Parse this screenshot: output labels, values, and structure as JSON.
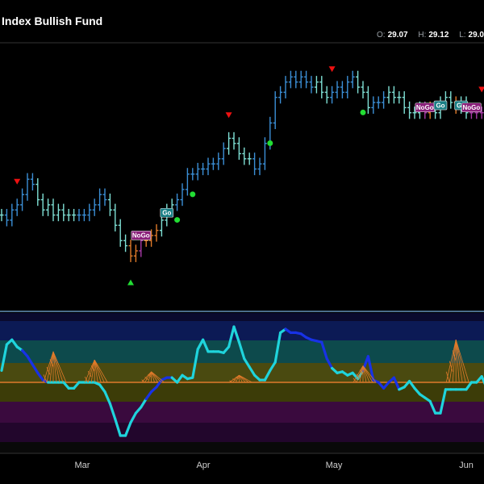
{
  "header": {
    "title": "Index Bullish Fund",
    "ohlc": [
      {
        "key": "O:",
        "value": "29.07"
      },
      {
        "key": "H:",
        "value": "29.12"
      },
      {
        "key": "L:",
        "value": "29.0"
      }
    ]
  },
  "colors": {
    "background": "#000000",
    "strong_up": "#3b8fd6",
    "weak_up": "#7fe0d5",
    "weak_down": "#e07a2a",
    "strong_down": "#a83aa8",
    "buy_marker": "#22dd33",
    "sell_marker": "#ee1111",
    "oscillator": "#1fd4dc",
    "oscillator_strong": "#1832e6",
    "zero_line": "#e07a2a",
    "tag_nogo": "#8a1f7a",
    "tag_go": "#1a7f86"
  },
  "chart_data": [
    {
      "type": "ohlc",
      "title": "Index Bullish Fund",
      "x_months": [
        "Mar",
        "Apr",
        "May",
        "Jun"
      ],
      "price_approx": [
        27.9,
        27.8,
        28.0,
        28.1,
        28.3,
        28.6,
        28.5,
        28.2,
        28.0,
        28.1,
        27.9,
        28.0,
        27.9,
        27.9,
        27.9,
        27.9,
        27.9,
        28.0,
        28.1,
        28.3,
        28.2,
        28.0,
        27.7,
        27.4,
        27.3,
        27.1,
        27.2,
        27.4,
        27.4,
        27.5,
        27.6,
        27.8,
        28.0,
        28.1,
        28.2,
        28.4,
        28.7,
        28.7,
        28.8,
        28.8,
        28.9,
        28.9,
        29.0,
        29.2,
        29.4,
        29.3,
        29.1,
        29.0,
        29.0,
        28.8,
        28.9,
        29.3,
        29.7,
        30.2,
        30.3,
        30.5,
        30.6,
        30.5,
        30.6,
        30.5,
        30.4,
        30.5,
        30.3,
        30.2,
        30.3,
        30.4,
        30.3,
        30.5,
        30.6,
        30.4,
        30.3,
        30.0,
        30.1,
        30.1,
        30.2,
        30.3,
        30.2,
        30.2,
        30.0,
        29.9,
        29.9,
        30.0,
        29.9,
        30.0,
        29.9,
        30.1,
        30.2,
        30.1,
        30.0,
        30.1,
        29.9,
        29.9,
        29.9,
        29.9,
        29.9
      ],
      "state": [
        "weak_up",
        "strong_up",
        "strong_up",
        "strong_up",
        "strong_up",
        "strong_up",
        "strong_up",
        "weak_up",
        "weak_up",
        "weak_up",
        "weak_up",
        "weak_up",
        "weak_up",
        "weak_up",
        "weak_up",
        "strong_up",
        "strong_up",
        "strong_up",
        "strong_up",
        "strong_up",
        "strong_up",
        "weak_up",
        "weak_up",
        "weak_up",
        "weak_up",
        "weak_down",
        "weak_down",
        "strong_down",
        "weak_down",
        "weak_down",
        "weak_down",
        "weak_up",
        "weak_up",
        "weak_up",
        "strong_up",
        "strong_up",
        "strong_up",
        "strong_up",
        "strong_up",
        "strong_up",
        "strong_up",
        "strong_up",
        "strong_up",
        "strong_up",
        "weak_up",
        "weak_up",
        "weak_up",
        "weak_up",
        "weak_up",
        "strong_up",
        "strong_up",
        "strong_up",
        "strong_up",
        "strong_up",
        "strong_up",
        "strong_up",
        "strong_up",
        "strong_up",
        "strong_up",
        "strong_up",
        "strong_up",
        "weak_up",
        "weak_up",
        "weak_up",
        "strong_up",
        "strong_up",
        "strong_up",
        "strong_up",
        "strong_up",
        "weak_up",
        "weak_up",
        "weak_up",
        "strong_up",
        "strong_up",
        "strong_up",
        "weak_up",
        "weak_up",
        "weak_up",
        "weak_up",
        "weak_up",
        "weak_up",
        "weak_up",
        "strong_down",
        "weak_down",
        "weak_up",
        "weak_up",
        "weak_up",
        "weak_up",
        "weak_down",
        "weak_up",
        "weak_up",
        "strong_down",
        "strong_down",
        "strong_down",
        "strong_down"
      ],
      "tags": [
        {
          "label": "NoGo",
          "kind": "nogo",
          "bar": 27
        },
        {
          "label": "Go",
          "kind": "go",
          "bar": 32
        },
        {
          "label": "NoGo",
          "kind": "nogo",
          "bar": 82
        },
        {
          "label": "Go",
          "kind": "go",
          "bar": 85
        },
        {
          "label": "Go",
          "kind": "go",
          "bar": 89
        },
        {
          "label": "NoGo",
          "kind": "nogo",
          "bar": 91
        }
      ],
      "markers": [
        {
          "kind": "sell",
          "bar": 3
        },
        {
          "kind": "buy",
          "bar": 25
        },
        {
          "kind": "dot",
          "bar": 34
        },
        {
          "kind": "dot",
          "bar": 37
        },
        {
          "kind": "sell",
          "bar": 44
        },
        {
          "kind": "dot",
          "bar": 52
        },
        {
          "kind": "sell",
          "bar": 64
        },
        {
          "kind": "dot",
          "bar": 70
        },
        {
          "kind": "sell",
          "bar": 93
        }
      ]
    },
    {
      "type": "line",
      "name": "",
      "oscillator_approx": [
        1,
        3.2,
        3.6,
        3.0,
        2.7,
        2.2,
        1.5,
        0.8,
        0.2,
        0,
        0,
        0,
        0,
        -0.5,
        -0.5,
        0,
        0,
        0,
        0,
        -0.2,
        -0.8,
        -1.8,
        -3.1,
        -4.5,
        -4.5,
        -3.4,
        -2.6,
        -2.1,
        -1.4,
        -0.8,
        -0.4,
        0.2,
        0.4,
        0.4,
        0,
        0.6,
        0.3,
        0.4,
        2.8,
        3.6,
        2.6,
        2.6,
        2.6,
        2.5,
        3.0,
        4.7,
        3.4,
        2.0,
        1.3,
        0.6,
        0.2,
        0.2,
        1.0,
        1.7,
        4.2,
        4.5,
        4.2,
        4.2,
        4.1,
        3.8,
        3.6,
        3.5,
        3.4,
        2.0,
        1.2,
        0.8,
        0.9,
        0.6,
        0.8,
        0.3,
        1.0,
        2.2,
        0.2,
        0.0,
        -0.5,
        0,
        0.4,
        -0.6,
        -0.4,
        0.1,
        -0.5,
        -1.0,
        -1.3,
        -1.6,
        -2.6,
        -2.6,
        -0.6,
        -0.6,
        -0.6,
        -0.6,
        -0.6,
        0,
        0,
        0.5,
        -0.5,
        -1.0,
        -1.0
      ],
      "strong_segments": [
        [
          4,
          9
        ],
        [
          28,
          33
        ],
        [
          55,
          64
        ],
        [
          70,
          77
        ]
      ],
      "zero_line": 0
    }
  ]
}
